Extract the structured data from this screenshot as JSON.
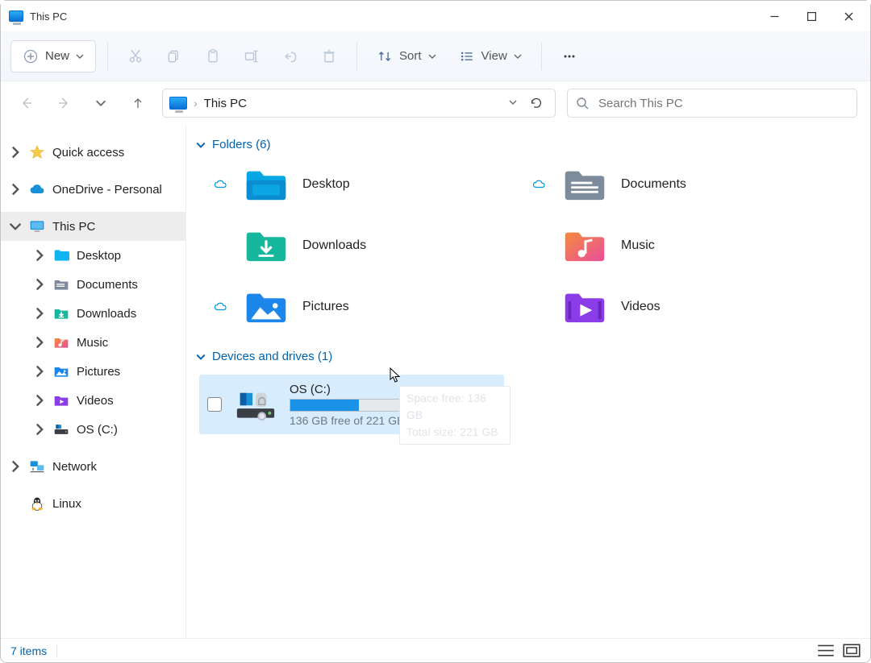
{
  "window": {
    "title": "This PC"
  },
  "toolbar": {
    "new_label": "New",
    "sort_label": "Sort",
    "view_label": "View"
  },
  "address": {
    "location": "This PC"
  },
  "search": {
    "placeholder": "Search This PC"
  },
  "sidebar": {
    "items": [
      {
        "label": "Quick access"
      },
      {
        "label": "OneDrive - Personal"
      },
      {
        "label": "This PC"
      },
      {
        "label": "Desktop"
      },
      {
        "label": "Documents"
      },
      {
        "label": "Downloads"
      },
      {
        "label": "Music"
      },
      {
        "label": "Pictures"
      },
      {
        "label": "Videos"
      },
      {
        "label": "OS (C:)"
      },
      {
        "label": "Network"
      },
      {
        "label": "Linux"
      }
    ]
  },
  "groups": {
    "folders_header": "Folders (6)",
    "drives_header": "Devices and drives (1)"
  },
  "folders": [
    {
      "label": "Desktop"
    },
    {
      "label": "Documents"
    },
    {
      "label": "Downloads"
    },
    {
      "label": "Music"
    },
    {
      "label": "Pictures"
    },
    {
      "label": "Videos"
    }
  ],
  "drive": {
    "name": "OS (C:)",
    "freeline": "136 GB free of 221 GB",
    "used_percent": 39
  },
  "tooltip": {
    "line1": "Space free: 136 GB",
    "line2": "Total size: 221 GB"
  },
  "status": {
    "count": "7 items"
  }
}
